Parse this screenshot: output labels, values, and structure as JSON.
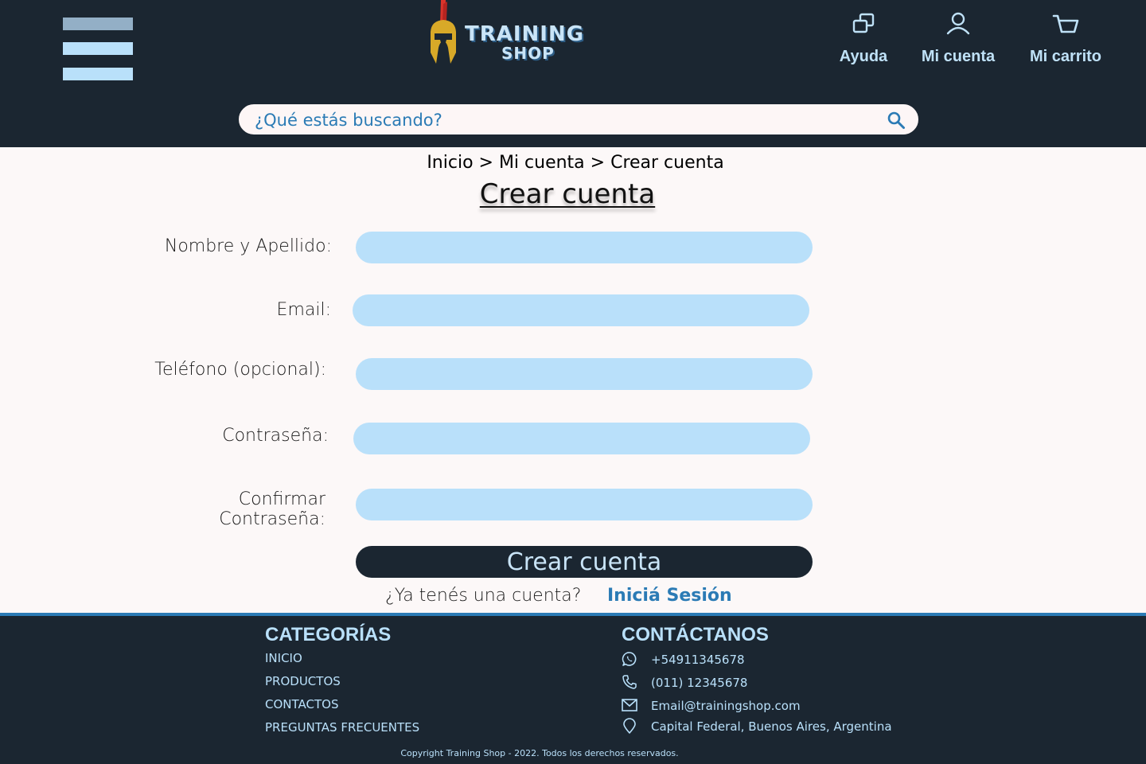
{
  "header": {
    "logo": {
      "line1": "TRAINING",
      "line2": "SHOP"
    },
    "nav": {
      "ayuda": "Ayuda",
      "mi_cuenta": "Mi cuenta",
      "mi_carrito": "Mi carrito"
    },
    "search": {
      "placeholder": "¿Qué estás buscando?"
    }
  },
  "main": {
    "breadcrumb": "Inicio > Mi cuenta > Crear cuenta",
    "title": "Crear cuenta",
    "form": {
      "fields": [
        {
          "label": "Nombre y Apellido:",
          "value": ""
        },
        {
          "label": "Email:",
          "value": ""
        },
        {
          "label": "Teléfono (opcional):",
          "value": ""
        },
        {
          "label": "Contraseña:",
          "value": ""
        },
        {
          "label": "Confirmar Contraseña:",
          "value": ""
        }
      ],
      "submit_label": "Crear cuenta",
      "already_text": "¿Ya tenés una cuenta?",
      "login_link": "Iniciá Sesión"
    }
  },
  "footer": {
    "categories_title": "CATEGORÍAS",
    "categories": [
      "INICIO",
      "PRODUCTOS",
      "CONTACTOS",
      "PREGUNTAS FRECUENTES"
    ],
    "contact_title": "CONTÁCTANOS",
    "contacts": [
      {
        "icon": "whatsapp-icon",
        "text": "+54911345678"
      },
      {
        "icon": "phone-icon",
        "text": "(011) 12345678"
      },
      {
        "icon": "mail-icon",
        "text": "Email@trainingshop.com"
      },
      {
        "icon": "location-pin-icon",
        "text": "Capital Federal, Buenos Aires, Argentina"
      }
    ],
    "copyright": "Copyright Training Shop - 2022. Todos los derechos reservados."
  },
  "colors": {
    "header_bg": "#1b2631",
    "accent_light": "#b9e0fa",
    "accent_blue": "#2b7bb5",
    "page_bg": "#fcf8f8"
  }
}
